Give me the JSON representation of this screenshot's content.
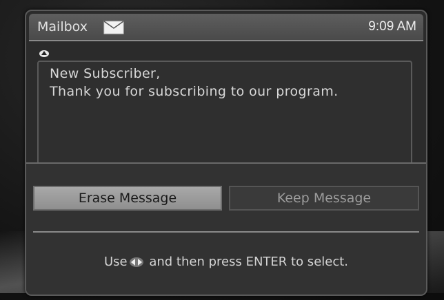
{
  "header": {
    "title": "Mailbox",
    "icon": "envelope-icon",
    "time": "9:09 AM"
  },
  "message": {
    "scroll_icon": "scroll-up-icon",
    "lines": [
      "New Subscriber,",
      "Thank you for subscribing to our program."
    ]
  },
  "actions": {
    "erase_label": "Erase Message",
    "keep_label": "Keep Message",
    "selected": "erase"
  },
  "hint": {
    "prefix": "Use",
    "icon": "left-right-arrows-icon",
    "suffix": " and then press ENTER to select."
  },
  "colors": {
    "panel": "#2b2b2b",
    "header": "#555555",
    "selected_button": "#9a9a9a",
    "text": "#d8d8d8"
  }
}
